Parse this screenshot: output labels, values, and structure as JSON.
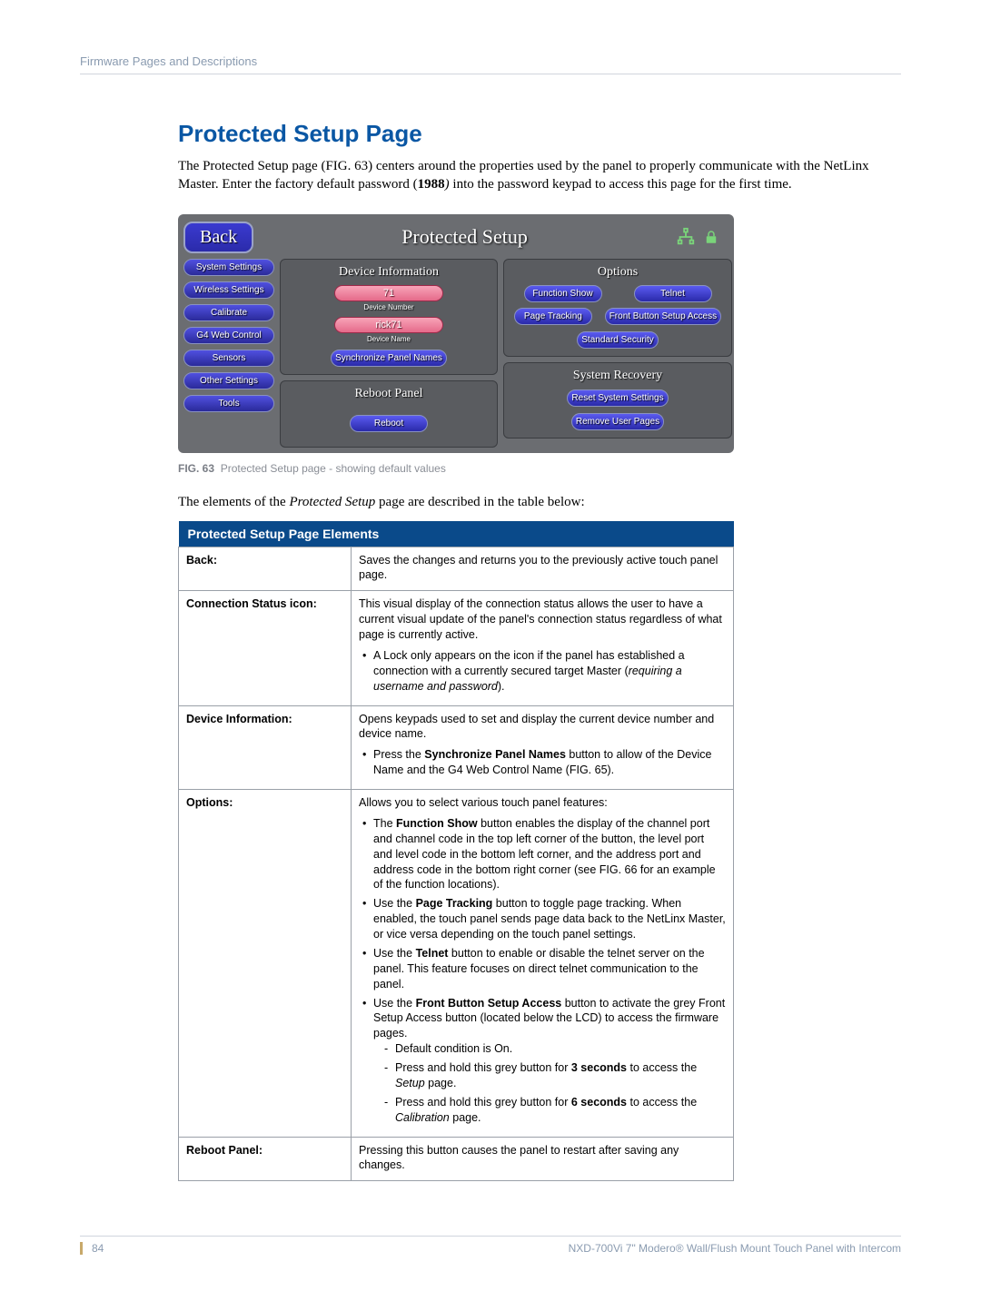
{
  "header": {
    "section": "Firmware Pages and Descriptions"
  },
  "heading": "Protected Setup Page",
  "intro": "The Protected Setup page (FIG. 63) centers around the properties used by the panel to properly communicate with the NetLinx Master. Enter the factory default password (1988) into the password keypad to access this page for the first time.",
  "intro_bold": "1988",
  "screenshot": {
    "back": "Back",
    "title": "Protected Setup",
    "side": [
      "System Settings",
      "Wireless Settings",
      "Calibrate",
      "G4 Web Control",
      "Sensors",
      "Other Settings",
      "Tools"
    ],
    "device_info": {
      "title": "Device Information",
      "number": "71",
      "number_lbl": "Device Number",
      "name": "rick71",
      "name_lbl": "Device Name",
      "sync": "Synchronize Panel Names"
    },
    "options": {
      "title": "Options",
      "b1": "Function Show",
      "b2": "Telnet",
      "b3": "Page Tracking",
      "b4": "Front Button Setup Access",
      "b5": "Standard Security"
    },
    "reboot": {
      "title": "Reboot Panel",
      "btn": "Reboot"
    },
    "recovery": {
      "title": "System Recovery",
      "b1": "Reset System Settings",
      "b2": "Remove User Pages"
    }
  },
  "fig": {
    "num": "FIG. 63",
    "text": "Protected Setup page - showing default values"
  },
  "lead": "The elements of the Protected Setup page are described in the table below:",
  "table": {
    "title": "Protected Setup Page Elements",
    "rows": [
      {
        "label": "Back:",
        "desc": "Saves the changes and returns you to the previously active touch panel page."
      },
      {
        "label": "Connection Status icon:",
        "desc": "This visual display of the connection status allows the user to have a current visual update of the panel's connection status regardless of what page is currently active.",
        "bullets": [
          "A Lock only appears on the icon if the panel has established a connection with a currently secured target Master (requiring a username and password)."
        ]
      },
      {
        "label": "Device Information:",
        "desc": "Opens keypads used to set and display the current device number and device name.",
        "bullets": [
          "Press the Synchronize Panel Names button to allow of the Device Name and the G4 Web Control Name (FIG. 65)."
        ]
      },
      {
        "label": "Options:",
        "desc": "Allows you to select various touch panel features:",
        "bullets": [
          "The Function Show button enables the display of the channel port and channel code in the top left corner of the button, the level port and level code in the bottom left corner, and the address port and address code in the bottom right corner (see FIG. 66 for an example of the function locations).",
          "Use the Page Tracking button to toggle page tracking. When enabled, the touch panel sends page data back to the NetLinx Master, or vice versa depending on the touch panel settings.",
          "Use the Telnet button to enable or disable the telnet server on the panel. This feature focuses on direct telnet communication to the panel.",
          "Use the Front Button Setup Access button to activate the grey Front Setup Access button (located below the LCD) to access the firmware pages."
        ],
        "dashes": [
          "Default condition is On.",
          "Press and hold this grey button for 3 seconds to access the Setup page.",
          "Press and hold this grey button for 6 seconds to access the Calibration page."
        ]
      },
      {
        "label": "Reboot Panel:",
        "desc": "Pressing this button causes the panel to restart after saving any changes."
      }
    ]
  },
  "footer": {
    "page": "84",
    "doc": "NXD-700Vi 7\" Modero® Wall/Flush Mount Touch Panel with Intercom"
  }
}
